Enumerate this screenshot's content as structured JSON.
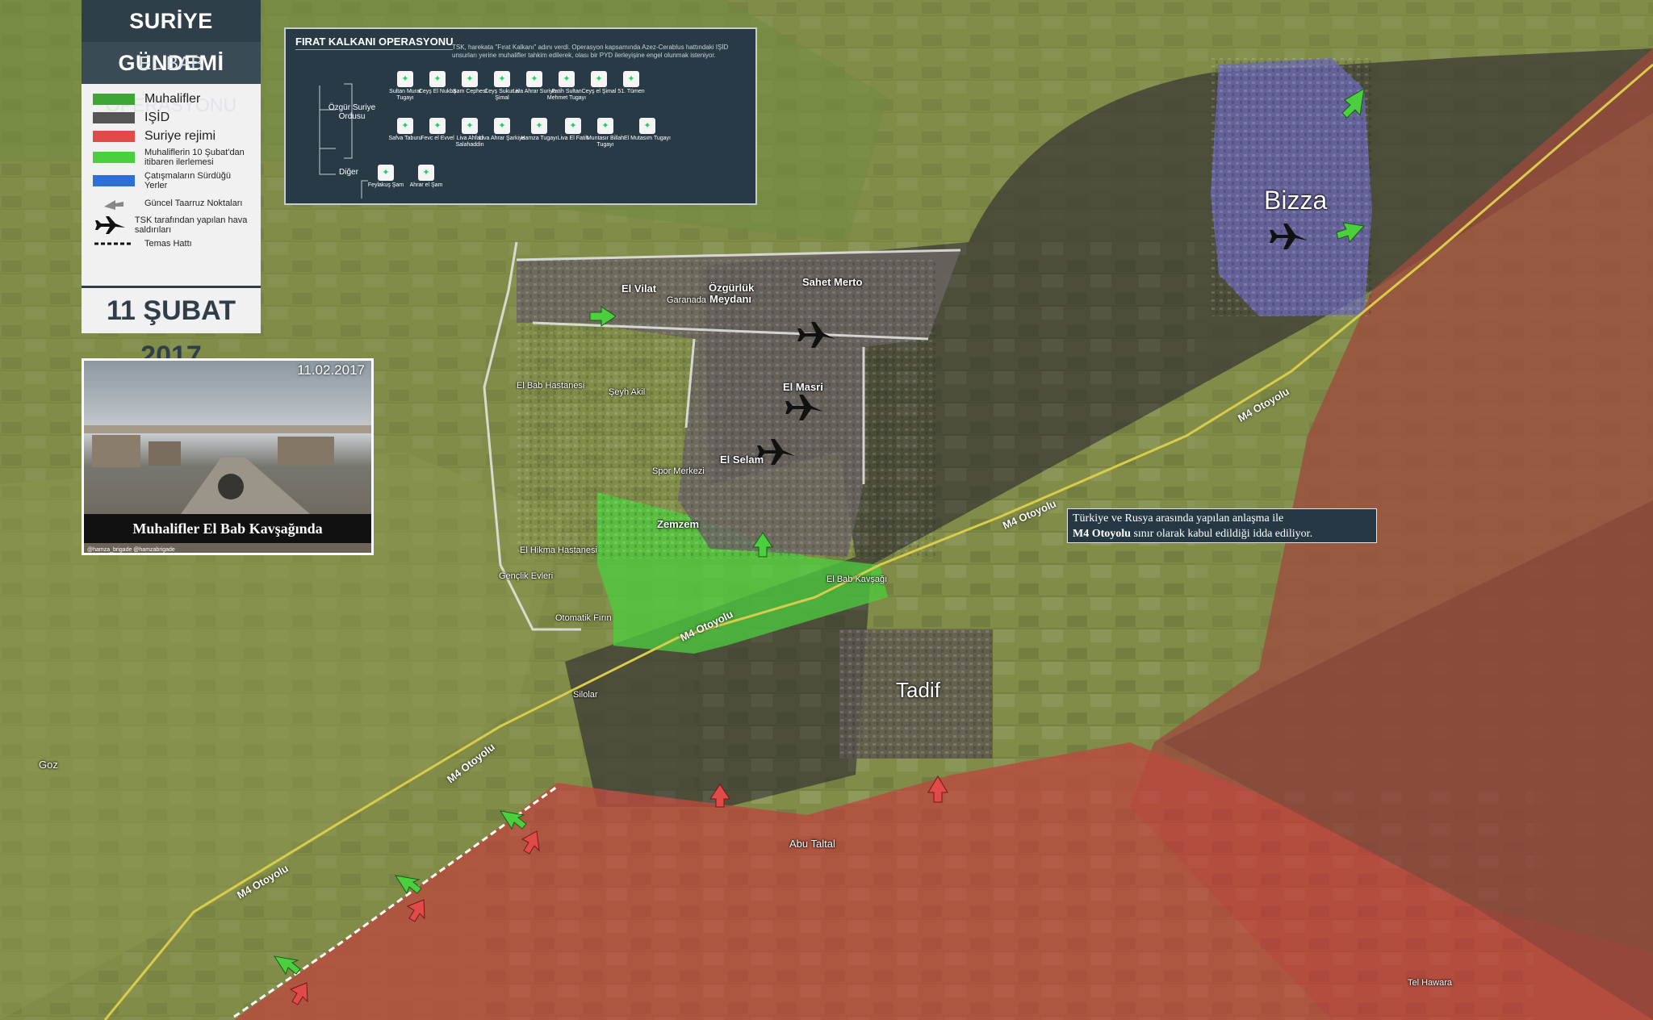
{
  "header": {
    "title": "SURİYE GÜNDEMİ",
    "subtitle": "EL BAB OPERASYONU",
    "date": "11 ŞUBAT 2017"
  },
  "legend": {
    "items": [
      {
        "label": "Muhalifler",
        "color": "#3fa635"
      },
      {
        "label": "IŞİD",
        "color": "#555555"
      },
      {
        "label": "Suriye rejimi",
        "color": "#e24a4a"
      },
      {
        "label": "Muhaliflerin 10 Şubat'dan itibaren ilerlemesi",
        "color": "#4ccf3e"
      },
      {
        "label": "Çatışmaların Sürdüğü Yerler",
        "color": "#2f6fd8"
      },
      {
        "label": "Güncel Taarruz Noktaları",
        "icon": "arrow-icon"
      },
      {
        "label": "TSK tarafından yapılan hava saldırıları",
        "icon": "jet-icon"
      },
      {
        "label": "Temas Hattı",
        "icon": "dashed-line-icon"
      }
    ]
  },
  "info_box": {
    "title": "FIRAT KALKANI OPERASYONU",
    "description": "TSK, harekata \"Fırat Kalkanı\" adını verdi. Operasyon kapsamında Azez-Cerablus hattındaki IŞİD unsurları yerine muhalifler tahkim edilerek, olası bir PYD ilerleyişine engel olunmak isteniyor.",
    "group_fsa": "Özgür Suriye Ordusu",
    "group_other": "Diğer",
    "factions_row1": [
      "Sultan Murat Tugayı",
      "Ceyş El Nukba",
      "Şam Cephesi",
      "Ceyş Sukur el Şimal",
      "Liva Ahrar Suriye",
      "Fatih Sultan Mehmet Tugayı",
      "Ceyş el Şimal",
      "51. Tümen"
    ],
    "factions_row2": [
      "Safva Taburu",
      "Fevc el Evvel",
      "Liva Ahfad Salahaddin",
      "Liva Ahrar Şarkiya",
      "Hamza Tugayı",
      "Liva El Fatih",
      "Muntasır Billah Tugayı",
      "El Mutasım Tugayı"
    ],
    "factions_other": [
      "Feylakuş Şam",
      "Ahrar el Şam"
    ]
  },
  "photo": {
    "date": "11.02.2017",
    "caption": "Muhalifler El Bab Kavşağında",
    "source": "@hamza_brigade  @hamzabrigade"
  },
  "note": {
    "line1": "Türkiye ve Rusya arasında yapılan anlaşma ile",
    "line2_bold": "M4 Otoyolu",
    "line2_rest": " sınır olarak kabul edildiği idda ediliyor."
  },
  "places": {
    "bizza": "Bizza",
    "tadif": "Tadif",
    "el_vilat": "El Vilat",
    "garanada": "Garanada",
    "ozgurluk": "Özgürlük Meydanı",
    "sahet_merto": "Sahet Merto",
    "el_masri": "El Masri",
    "el_selam": "El Selam",
    "spor_merkezi": "Spor Merkezi",
    "zemzem": "Zemzem",
    "el_bab_hastanesi": "El Bab Hastanesi",
    "seyh_akil": "Şeyh Akil",
    "el_hikma": "El Hikma Hastanesi",
    "genclik_evleri": "Gençlik Evleri",
    "otomatik_firin": "Otomatik Fırın",
    "silolar": "Silolar",
    "el_bab_kavsagi": "El Bab Kavşağı",
    "abu_taltal": "Abu Taltal",
    "goz": "Goz",
    "tel_hawara": "Tel Hawara"
  },
  "roads": {
    "m4": "M4 Otoyolu"
  },
  "colors": {
    "rebels": "#3fa635",
    "isis": "#555555",
    "regime": "#e24a4a",
    "advance": "#4ccf3e",
    "clash": "#2f6fd8",
    "panel": "#2f3f49"
  }
}
